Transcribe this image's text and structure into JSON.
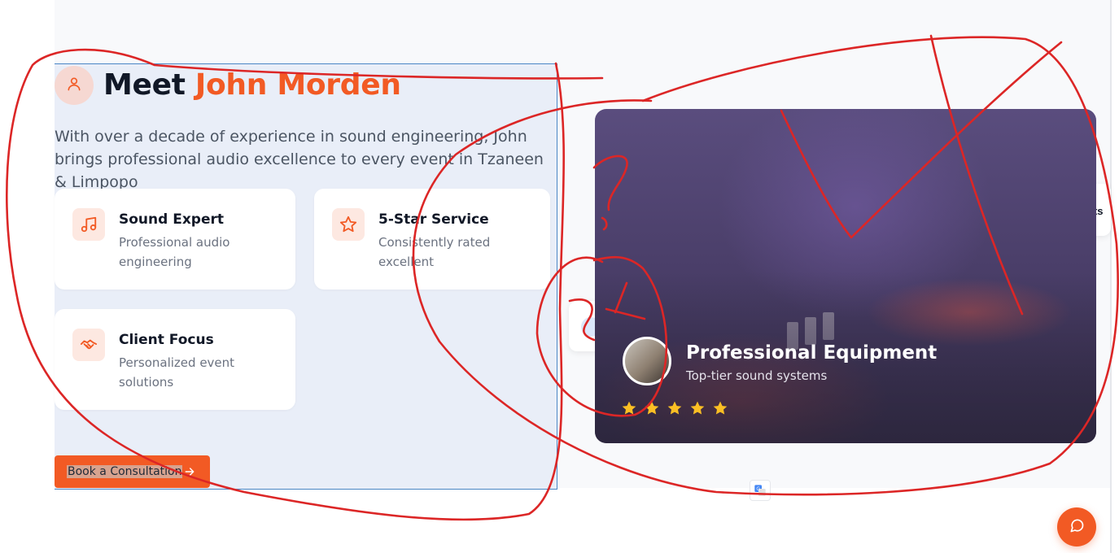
{
  "about": {
    "title_prefix": "Meet",
    "title_name": "John Morden",
    "intro": "With over a decade of experience in sound engineering, John brings professional audio excellence to every event in Tzaneen & Limpopo",
    "features": [
      {
        "title": "Sound Expert",
        "desc": "Professional audio engineering",
        "icon": "music-note-icon"
      },
      {
        "title": "5-Star Service",
        "desc": "Consistently rated excellent",
        "icon": "star-icon"
      },
      {
        "title": "Client Focus",
        "desc": "Personalized event solutions",
        "icon": "handshake-icon"
      }
    ],
    "cta_label": "Book a Consultation"
  },
  "hero": {
    "title": "Professional Equipment",
    "subtitle": "Top-tier sound systems",
    "rating": 5,
    "peek_text": "nts"
  },
  "colors": {
    "accent": "#f25a24",
    "star": "#fbbf24",
    "annotation": "#dc2626"
  }
}
